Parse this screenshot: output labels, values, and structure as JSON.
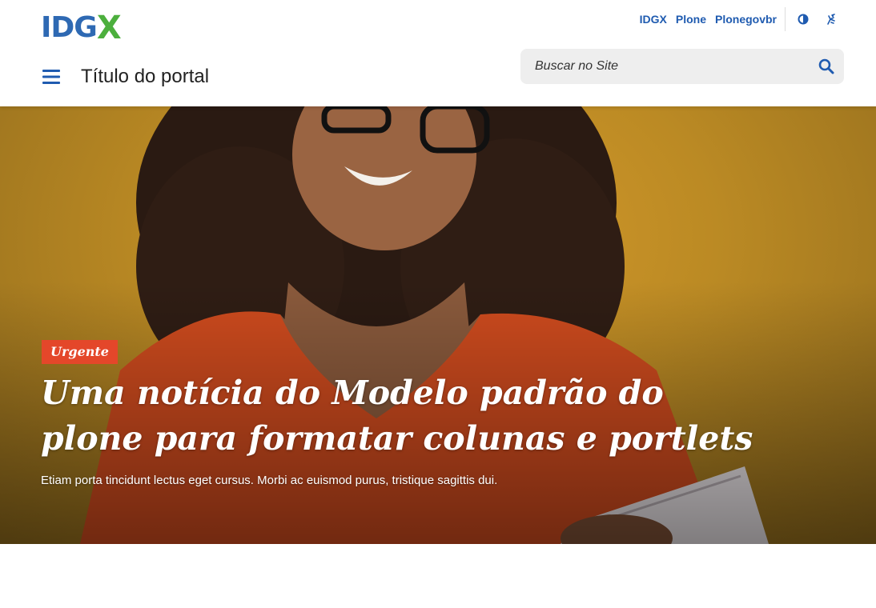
{
  "header": {
    "logo_text": "IDG",
    "logo_accent": "X",
    "top_links": [
      "IDGX",
      "Plone",
      "Plonegovbr"
    ],
    "portal_title": "Título do portal",
    "search_placeholder": "Buscar no Site",
    "icons": {
      "contrast": "contrast-icon",
      "accessibility": "sign-language-icon",
      "menu": "hamburger-menu-icon",
      "search": "search-icon"
    }
  },
  "hero": {
    "badge": "Urgente",
    "headline": "Uma notícia do Modelo padrão do plone para formatar colunas e portlets",
    "summary": "Etiam porta tincidunt lectus eget cursus. Morbi ac euismod purus, tristique sagittis dui."
  },
  "colors": {
    "primary_blue": "#1f5bb0",
    "logo_green": "#4caf3d",
    "badge_red": "#e4472a",
    "hero_background": "#c8922a"
  }
}
